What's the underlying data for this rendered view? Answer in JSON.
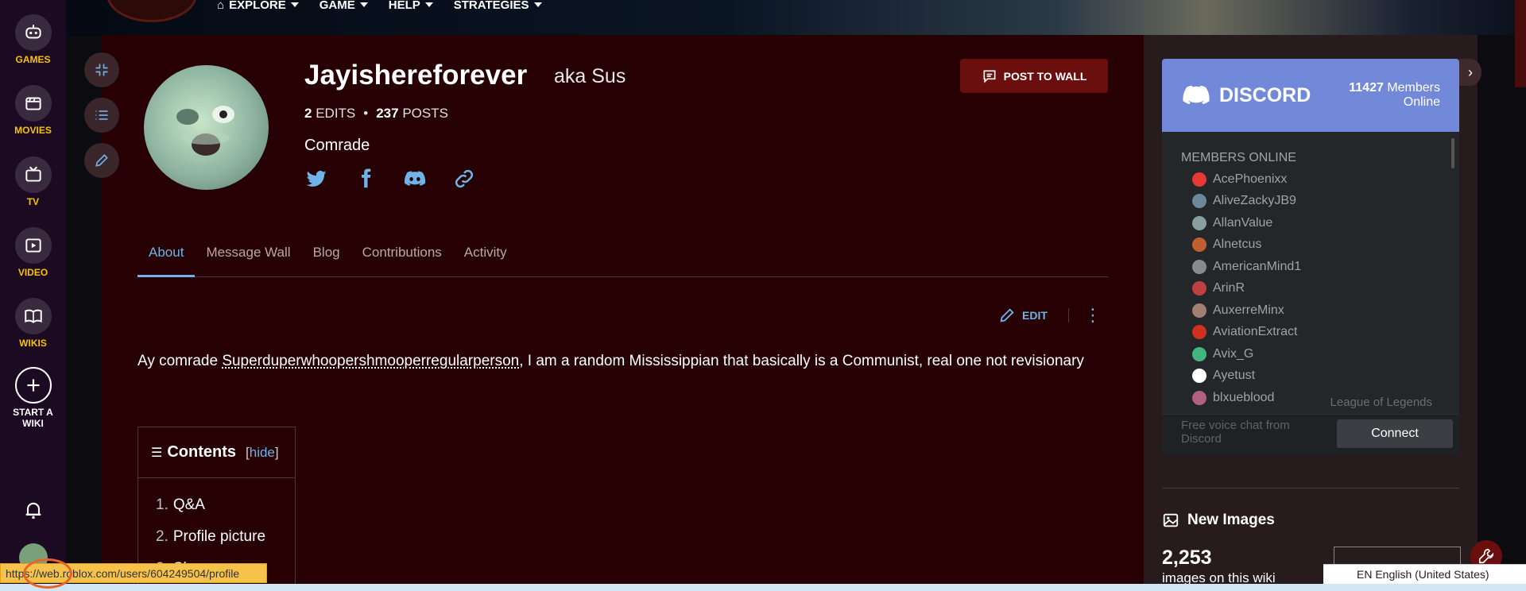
{
  "topnav": {
    "explore": "EXPLORE",
    "game": "GAME",
    "help": "HELP",
    "strategies": "STRATEGIES"
  },
  "leftnav": {
    "games": "GAMES",
    "movies": "MOVIES",
    "tv": "TV",
    "video": "VIDEO",
    "wikis": "WIKIS",
    "start_wiki_1": "START A",
    "start_wiki_2": "WIKI"
  },
  "profile": {
    "username": "Jayishereforever",
    "aka": "aka Sus",
    "edits_count": "2",
    "edits_label": "EDITS",
    "posts_count": "237",
    "posts_label": "POSTS",
    "tagline": "Comrade",
    "post_to_wall": "POST TO WALL"
  },
  "tabs": [
    "About",
    "Message Wall",
    "Blog",
    "Contributions",
    "Activity"
  ],
  "edit_label": "EDIT",
  "body": {
    "pre": "Ay comrade ",
    "link": "Superduperwhoopershmooperregularperson",
    "post": ", I am a random Mississippian that basically is a Communist, real one not revisionary"
  },
  "toc": {
    "title": "Contents",
    "hide": "hide",
    "items": [
      {
        "n": "1.",
        "t": "Q&A"
      },
      {
        "n": "2.",
        "t": "Profile picture"
      },
      {
        "n": "3.",
        "t": "Sh"
      }
    ]
  },
  "discord": {
    "brand": "DISCORD",
    "online_count": "11427",
    "online_label_1": "Members",
    "online_label_2": "Online",
    "members_header": "MEMBERS ONLINE",
    "members": [
      {
        "name": "AcePhoenixx",
        "color": "#e53935"
      },
      {
        "name": "AliveZackyJB9",
        "color": "#6a8a9a"
      },
      {
        "name": "AllanValue",
        "color": "#8aa0a0"
      },
      {
        "name": "Alnetcus",
        "color": "#c06030"
      },
      {
        "name": "AmericanMind1",
        "color": "#8a8a8a"
      },
      {
        "name": "ArinR",
        "color": "#c04040"
      },
      {
        "name": "AuxerreMinx",
        "color": "#a08070"
      },
      {
        "name": "AviationExtract",
        "color": "#d03020"
      },
      {
        "name": "Avix_G",
        "color": "#43b581"
      },
      {
        "name": "Ayetust",
        "color": "#ffffff"
      },
      {
        "name": "blxueblood",
        "color": "#b06080"
      }
    ],
    "game": "League of Legends",
    "free_voice": "Free voice chat from Discord",
    "connect": "Connect"
  },
  "rail": {
    "new_images": "New Images",
    "count": "2,253",
    "sub": "images on this wiki"
  },
  "status_url": "https://web.roblox.com/users/604249504/profile",
  "language": "EN English (United States)"
}
